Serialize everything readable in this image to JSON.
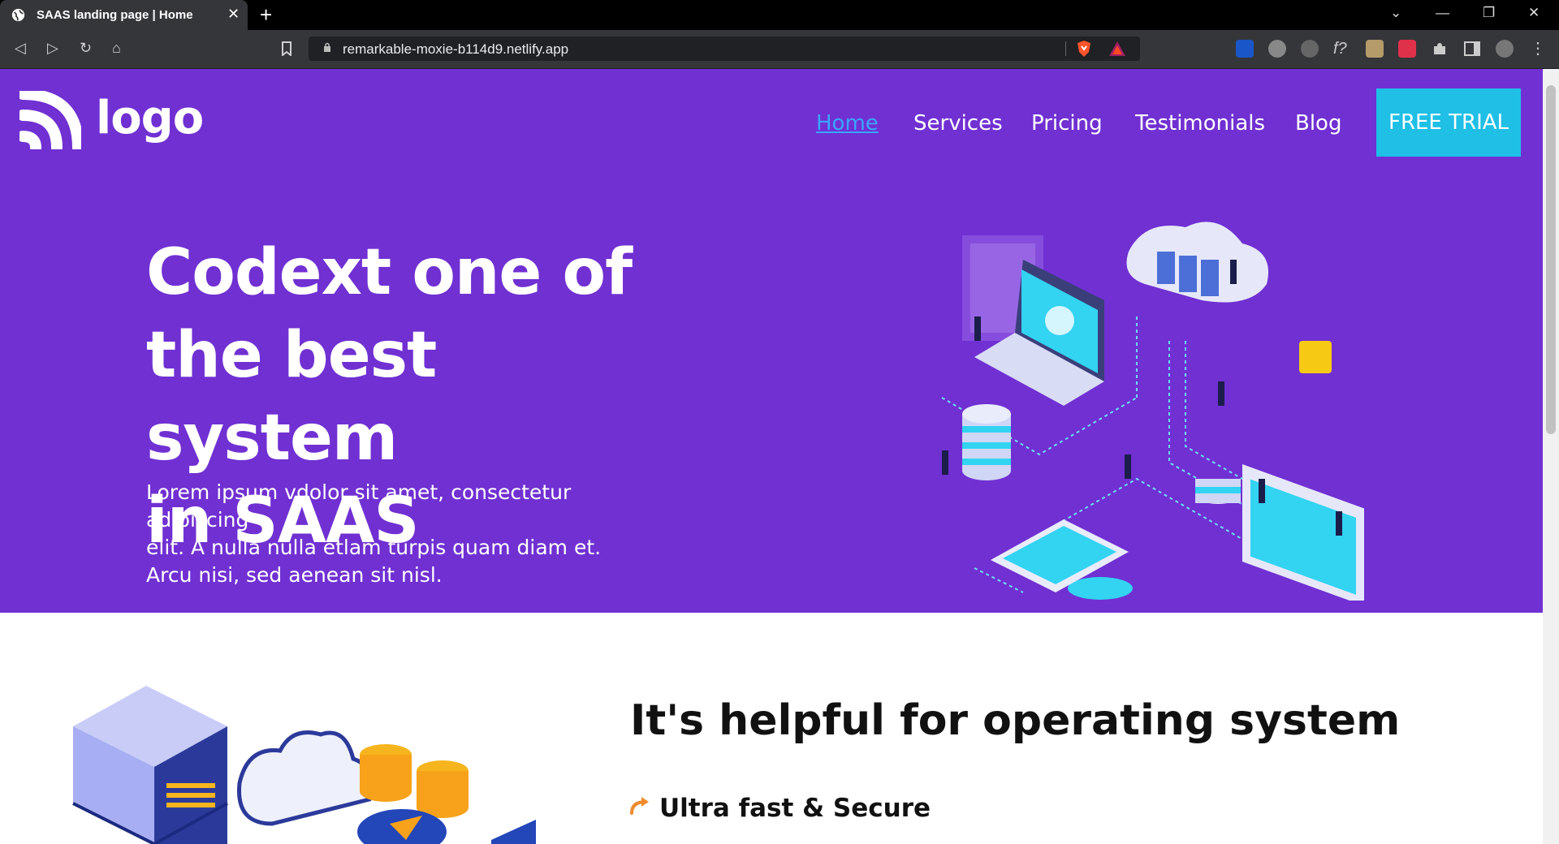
{
  "browser": {
    "tab_title": "SAAS landing page | Home",
    "tab_close": "✕",
    "new_tab": "+",
    "url": "remarkable-moxie-b114d9.netlify.app",
    "window_controls": [
      "⌄",
      "—",
      "❐",
      "✕"
    ],
    "nav_buttons": [
      "◁",
      "▷",
      "↻",
      "⌂"
    ]
  },
  "header": {
    "logo_text": "logo",
    "nav": [
      {
        "label": "Home",
        "active": true
      },
      {
        "label": "Services",
        "active": false
      },
      {
        "label": "Pricing",
        "active": false
      },
      {
        "label": "Testimonials",
        "active": false
      },
      {
        "label": "Blog",
        "active": false
      }
    ],
    "cta_label": "FREE TRIAL"
  },
  "hero": {
    "title_lines": [
      "Codext one of",
      "the best system",
      "in SAAS"
    ],
    "subtitle_lines": [
      "Lorem ipsum vdolor sit amet, consectetur adipiscing",
      "elit. A nulla nulla etlam turpis quam diam et.",
      "Arcu nisi, sed aenean sit nisl."
    ]
  },
  "features": {
    "title": "It's helpful for operating system",
    "items": [
      "Ultra fast & Secure"
    ]
  },
  "colors": {
    "hero_bg": "#7030d2",
    "cta_bg": "#1fbfe6",
    "active_link": "#3aa6ff",
    "feature_arrow": "#f08a2c"
  }
}
